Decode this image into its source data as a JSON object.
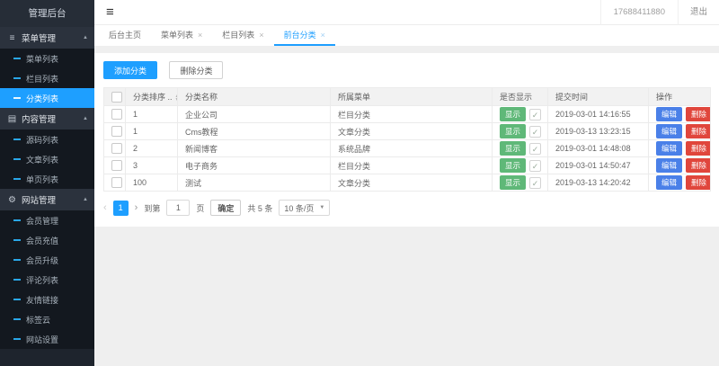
{
  "icons": {
    "menu": "≡",
    "content": "▤",
    "gear": "⚙",
    "collapse": "▲",
    "hamburger": "≡",
    "close": "×",
    "check": "✓",
    "sort_up": "▲",
    "sort_down": "▼",
    "prev": "‹",
    "next": "›",
    "caret": "▼"
  },
  "colors": {
    "primary_blue": "#1E9FFF",
    "green": "#5FB878",
    "edit_blue": "#4a80e8",
    "delete_red": "#e0463c",
    "sidebar_dark": "#1e242d"
  },
  "sidebar": {
    "title": "管理后台",
    "groups": [
      {
        "label": "菜单管理",
        "children": [
          "菜单列表",
          "栏目列表",
          "分类列表"
        ]
      },
      {
        "label": "内容管理",
        "children": [
          "源码列表",
          "文章列表",
          "单页列表"
        ]
      },
      {
        "label": "网站管理",
        "children": [
          "会员管理",
          "会员充值",
          "会员升级",
          "评论列表",
          "友情链接",
          "标签云",
          "网站设置"
        ]
      }
    ]
  },
  "header": {
    "username": "17688411880",
    "logout": "退出"
  },
  "tabs": [
    {
      "label": "后台主页"
    },
    {
      "label": "菜单列表"
    },
    {
      "label": "栏目列表"
    },
    {
      "label": "前台分类"
    }
  ],
  "toolbar": {
    "add_label": "添加分类",
    "delete_label": "删除分类"
  },
  "table": {
    "headers": [
      "分类排序 ..",
      "分类名称",
      "所属菜单",
      "是否显示",
      "提交时间",
      "操作"
    ],
    "show_label": "显示",
    "edit_label": "编辑",
    "delete_label": "删除",
    "rows": [
      {
        "order": "1",
        "name": "企业公司",
        "menu": "栏目分类",
        "time": "2019-03-01 14:16:55"
      },
      {
        "order": "1",
        "name": "Cms教程",
        "menu": "文章分类",
        "time": "2019-03-13 13:23:15"
      },
      {
        "order": "2",
        "name": "新闻博客",
        "menu": "系统品牌",
        "time": "2019-03-01 14:48:08"
      },
      {
        "order": "3",
        "name": "电子商务",
        "menu": "栏目分类",
        "time": "2019-03-01 14:50:47"
      },
      {
        "order": "100",
        "name": "测试",
        "menu": "文章分类",
        "time": "2019-03-13 14:20:42"
      }
    ]
  },
  "pagination": {
    "current_page": "1",
    "goto_label": "到第",
    "goto_value": "1",
    "page_word": "页",
    "confirm_label": "确定",
    "total_label": "共 5 条",
    "page_size_label": "10 条/页"
  }
}
